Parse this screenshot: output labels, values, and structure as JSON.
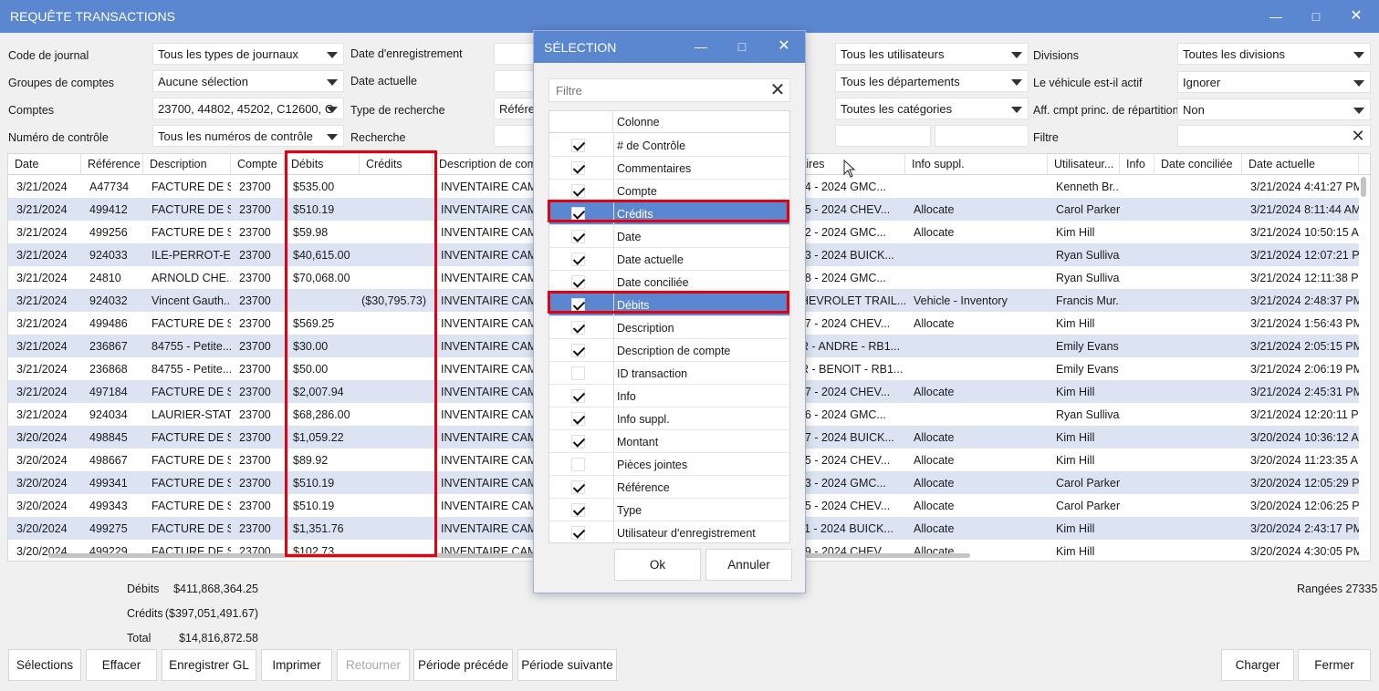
{
  "window": {
    "title": "REQUÊTE TRANSACTIONS"
  },
  "filters": {
    "left": [
      {
        "label": "Code de journal",
        "value": "Tous les types de journaux"
      },
      {
        "label": "Groupes de comptes",
        "value": "Aucune sélection"
      },
      {
        "label": "Comptes",
        "value": "23700, 44802, 45202, C12600, C"
      },
      {
        "label": "Numéro de contrôle",
        "value": "Tous les numéros de contrôle"
      }
    ],
    "middle": [
      {
        "label": "Date d'enregistrement"
      },
      {
        "label": "Date actuelle"
      },
      {
        "label": "Type de recherche",
        "value": "Référe"
      },
      {
        "label": "Recherche"
      }
    ],
    "right_combos": [
      "Tous les utilisateurs",
      "Tous les départements",
      "Toutes les catégories"
    ],
    "far_right": [
      {
        "label": "Divisions",
        "value": "Toutes les divisions"
      },
      {
        "label": "Le véhicule est-il actif",
        "value": "Ignorer"
      },
      {
        "label": "Aff. cmpt princ. de répartition",
        "value": "Non"
      },
      {
        "label": "Filtre",
        "value": ""
      }
    ]
  },
  "grid": {
    "headers": [
      "Date",
      "Référence",
      "Description",
      "Compte",
      "Débits",
      "Crédits",
      "Description de com",
      "ntaires",
      "Info suppl.",
      "Utilisateur...",
      "Info",
      "Date conciliée",
      "Date actuelle"
    ],
    "rows": [
      [
        "3/21/2024",
        "A47734",
        "FACTURE DE S...",
        "23700",
        "$535.00",
        "",
        "INVENTAIRE CAMIO",
        "194 - 2024 GMC...",
        "",
        "Kenneth Br...",
        "",
        "",
        "3/21/2024 4:41:27 PM"
      ],
      [
        "3/21/2024",
        "499412",
        "FACTURE DE S...",
        "23700",
        "$510.19",
        "",
        "INVENTAIRE CAMIO",
        "885 - 2024 CHEV...",
        "Allocate",
        "Carol Parker",
        "",
        "",
        "3/21/2024 8:11:44 AM"
      ],
      [
        "3/21/2024",
        "499256",
        "FACTURE DE S...",
        "23700",
        "$59.98",
        "",
        "INVENTAIRE CAMIO",
        "092 - 2024 GMC...",
        "Allocate",
        "Kim Hill",
        "",
        "",
        "3/21/2024 10:50:15 A"
      ],
      [
        "3/21/2024",
        "924033",
        "ILE-PERROT-E...",
        "23700",
        "$40,615.00",
        "",
        "INVENTAIRE CAMIO",
        "133 - 2024 BUICK...",
        "",
        "Ryan Sullivan",
        "",
        "",
        "3/21/2024 12:07:21 P"
      ],
      [
        "3/21/2024",
        "24810",
        "ARNOLD CHE...",
        "23700",
        "$70,068.00",
        "",
        "INVENTAIRE CAMIO",
        "738 - 2024 GMC...",
        "",
        "Ryan Sullivan",
        "",
        "",
        "3/21/2024 12:11:38 P"
      ],
      [
        "3/21/2024",
        "924032",
        "Vincent Gauth...",
        "23700",
        "",
        "($30,795.73)",
        "INVENTAIRE CAMIO",
        "CHEVROLET TRAIL...",
        "Vehicle - Inventory",
        "Francis Mur...",
        "",
        "",
        "3/21/2024 2:48:37 PM"
      ],
      [
        "3/21/2024",
        "499486",
        "FACTURE DE S...",
        "23700",
        "$569.25",
        "",
        "INVENTAIRE CAMIO",
        "417 - 2024 CHEV...",
        "Allocate",
        "Kim Hill",
        "",
        "",
        "3/21/2024 1:56:43 PM"
      ],
      [
        "3/21/2024",
        "236867",
        "84755 - Petite...",
        "23700",
        "$30.00",
        "",
        "INVENTAIRE CAMIO",
        "UR - ANDRE - RB1...",
        "",
        "Emily Evans",
        "",
        "",
        "3/21/2024 2:05:15 PM"
      ],
      [
        "3/21/2024",
        "236868",
        "84755 - Petite...",
        "23700",
        "$50.00",
        "",
        "INVENTAIRE CAMIO",
        "UR - BENOIT - RB1...",
        "",
        "Emily Evans",
        "",
        "",
        "3/21/2024 2:06:19 PM"
      ],
      [
        "3/21/2024",
        "497184",
        "FACTURE DE S...",
        "23700",
        "$2,007.94",
        "",
        "INVENTAIRE CAMIO",
        "267 - 2024 CHEV...",
        "Allocate",
        "Kim Hill",
        "",
        "",
        "3/21/2024 2:45:31 PM"
      ],
      [
        "3/21/2024",
        "924034",
        "LAURIER-STAT...",
        "23700",
        "$68,286.00",
        "",
        "INVENTAIRE CAMIO",
        "756 - 2024 GMC...",
        "",
        "Ryan Sullivan",
        "",
        "",
        "3/21/2024 12:20:11 P"
      ],
      [
        "3/20/2024",
        "498845",
        "FACTURE DE S...",
        "23700",
        "$1,059.22",
        "",
        "INVENTAIRE CAMIO",
        "757 - 2024 BUICK...",
        "Allocate",
        "Kim Hill",
        "",
        "",
        "3/20/2024 10:36:12 A"
      ],
      [
        "3/20/2024",
        "498667",
        "FACTURE DE S...",
        "23700",
        "$89.92",
        "",
        "INVENTAIRE CAMIO",
        "945 - 2024 CHEV...",
        "Allocate",
        "Kim Hill",
        "",
        "",
        "3/20/2024 11:23:35 A"
      ],
      [
        "3/20/2024",
        "499341",
        "FACTURE DE S...",
        "23700",
        "$510.19",
        "",
        "INVENTAIRE CAMIO",
        "343 - 2024 GMC...",
        "Allocate",
        "Carol Parker",
        "",
        "",
        "3/20/2024 12:05:29 P"
      ],
      [
        "3/20/2024",
        "499343",
        "FACTURE DE S...",
        "23700",
        "$510.19",
        "",
        "INVENTAIRE CAMIO",
        "695 - 2024 CHEV...",
        "Allocate",
        "Carol Parker",
        "",
        "",
        "3/20/2024 12:06:25 P"
      ],
      [
        "3/20/2024",
        "499275",
        "FACTURE DE S...",
        "23700",
        "$1,351.76",
        "",
        "INVENTAIRE CAMIO",
        "511 - 2024 BUICK...",
        "Allocate",
        "Kim Hill",
        "",
        "",
        "3/20/2024 2:43:17 PM"
      ],
      [
        "3/20/2024",
        "499229",
        "FACTURE DE S...",
        "23700",
        "$102.73",
        "",
        "INVENTAIRE CAMIO",
        "689 - 2024 CHEV...",
        "Allocate",
        "Kim Hill",
        "",
        "",
        "3/20/2024 4:30:05 PM"
      ]
    ]
  },
  "totals": {
    "debits_label": "Débits",
    "debits_value": "$411,868,364.25",
    "credits_label": "Crédits",
    "credits_value": "($397,051,491.67)",
    "total_label": "Total",
    "total_value": "$14,816,872.58",
    "rows_label": "Rangées 27335"
  },
  "buttons": {
    "selections": "Sélections",
    "clear": "Effacer",
    "save": "Enregistrer  GL",
    "print": "Imprimer",
    "return": "Retourner",
    "prev_period": "Période précéde",
    "next_period": "Période suivante",
    "load": "Charger",
    "close": "Fermer"
  },
  "dialog": {
    "title": "SÉLECTION",
    "filter_placeholder": "Filtre",
    "column_header": "Colonne",
    "items": [
      {
        "name": "# de Contrôle",
        "checked": true,
        "selected": false
      },
      {
        "name": "Commentaires",
        "checked": true,
        "selected": false
      },
      {
        "name": "Compte",
        "checked": true,
        "selected": false
      },
      {
        "name": "Crédits",
        "checked": true,
        "selected": true
      },
      {
        "name": "Date",
        "checked": true,
        "selected": false
      },
      {
        "name": "Date actuelle",
        "checked": true,
        "selected": false
      },
      {
        "name": "Date conciliée",
        "checked": true,
        "selected": false
      },
      {
        "name": "Débits",
        "checked": true,
        "selected": true
      },
      {
        "name": "Description",
        "checked": true,
        "selected": false
      },
      {
        "name": "Description de compte",
        "checked": true,
        "selected": false
      },
      {
        "name": "ID transaction",
        "checked": false,
        "selected": false
      },
      {
        "name": "Info",
        "checked": true,
        "selected": false
      },
      {
        "name": "Info suppl.",
        "checked": true,
        "selected": false
      },
      {
        "name": "Montant",
        "checked": true,
        "selected": false
      },
      {
        "name": "Pièces jointes",
        "checked": false,
        "selected": false
      },
      {
        "name": "Référence",
        "checked": true,
        "selected": false
      },
      {
        "name": "Type",
        "checked": true,
        "selected": false
      },
      {
        "name": "Utilisateur d'enregistrement",
        "checked": true,
        "selected": false
      }
    ],
    "ok": "Ok",
    "cancel": "Annuler"
  },
  "colors": {
    "titlebar": "#5b86d0",
    "row_alt": "#dce4f3",
    "highlight": "#e3000f"
  }
}
